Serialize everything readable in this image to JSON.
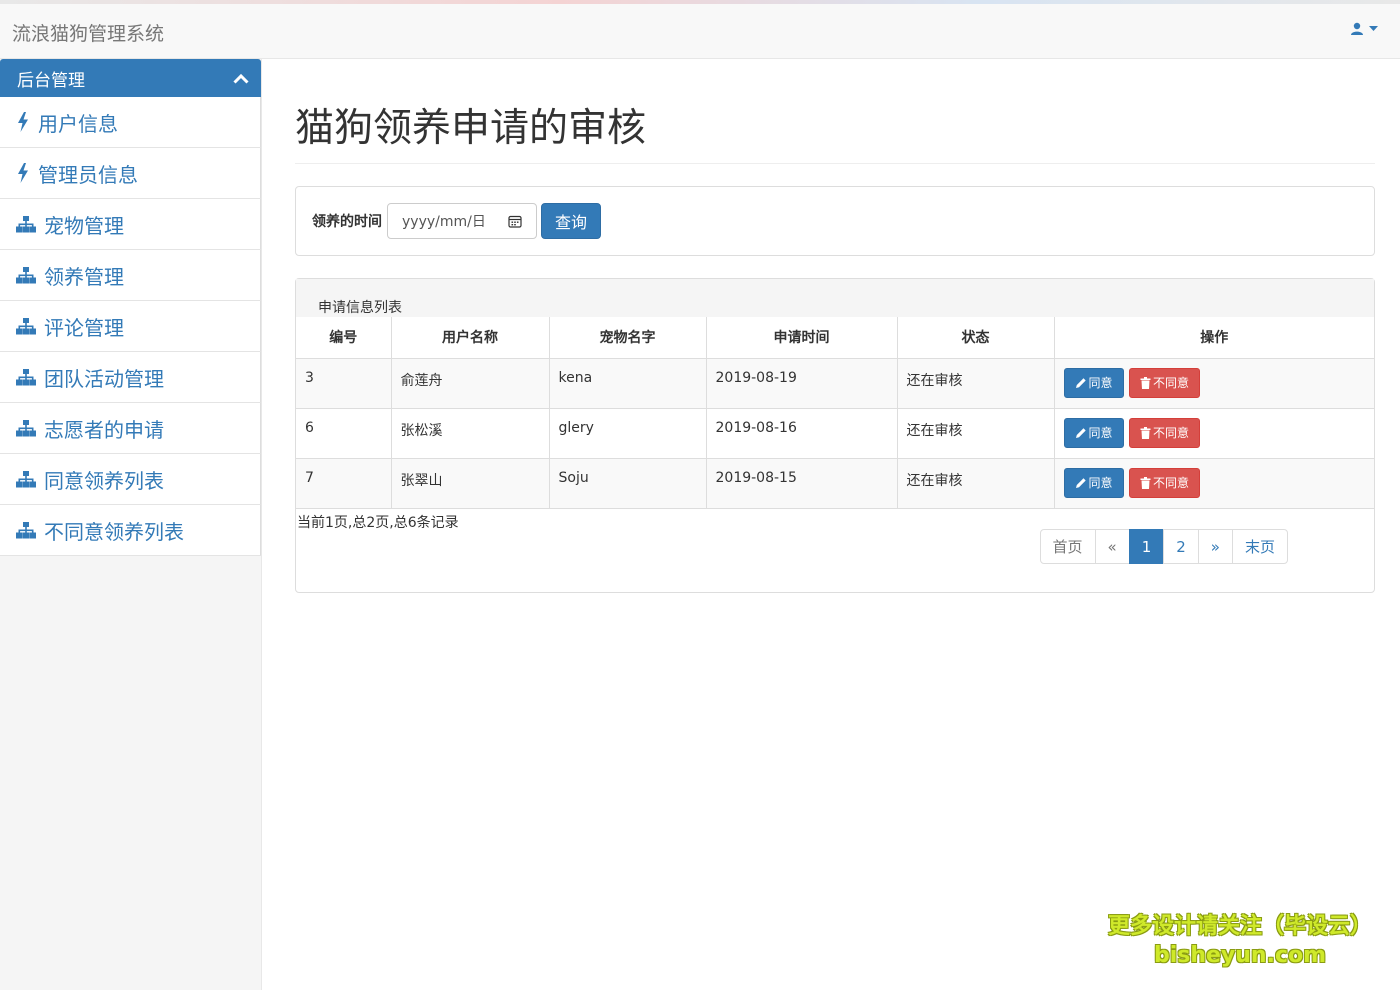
{
  "app": {
    "title": "流浪猫狗管理系统"
  },
  "colors": {
    "primary": "#337ab7",
    "danger": "#d9534f"
  },
  "sidebar": {
    "header": "后台管理",
    "items": [
      {
        "label": "用户信息",
        "icon": "bolt-icon"
      },
      {
        "label": "管理员信息",
        "icon": "bolt-icon"
      },
      {
        "label": "宠物管理",
        "icon": "sitemap-icon"
      },
      {
        "label": "领养管理",
        "icon": "sitemap-icon"
      },
      {
        "label": "评论管理",
        "icon": "sitemap-icon"
      },
      {
        "label": "团队活动管理",
        "icon": "sitemap-icon"
      },
      {
        "label": "志愿者的申请",
        "icon": "sitemap-icon"
      },
      {
        "label": "同意领养列表",
        "icon": "sitemap-icon"
      },
      {
        "label": "不同意领养列表",
        "icon": "sitemap-icon"
      }
    ]
  },
  "main": {
    "title": "猫狗领养申请的审核",
    "filter": {
      "label": "领养的时间",
      "placeholder": "yyyy/mm/日",
      "button": "查询"
    },
    "panel": {
      "heading": "申请信息列表",
      "columns": [
        "编号",
        "用户名称",
        "宠物名字",
        "申请时间",
        "状态",
        "操作"
      ],
      "rows": [
        {
          "id": "3",
          "user": "俞莲舟",
          "pet": "kena",
          "date": "2019-08-19",
          "status": "还在审核"
        },
        {
          "id": "6",
          "user": "张松溪",
          "pet": "glery",
          "date": "2019-08-16",
          "status": "还在审核"
        },
        {
          "id": "7",
          "user": "张翠山",
          "pet": "Soju",
          "date": "2019-08-15",
          "status": "还在审核"
        }
      ],
      "agree_label": "同意",
      "disagree_label": "不同意",
      "page_info": "当前1页,总2页,总6条记录",
      "pagination": {
        "first": "首页",
        "prev": "«",
        "pages": [
          "1",
          "2"
        ],
        "next": "»",
        "last": "末页",
        "current": "1"
      }
    }
  },
  "watermark": {
    "line1": "更多设计请关注（毕设云）",
    "line2": "bisheyun.com"
  }
}
